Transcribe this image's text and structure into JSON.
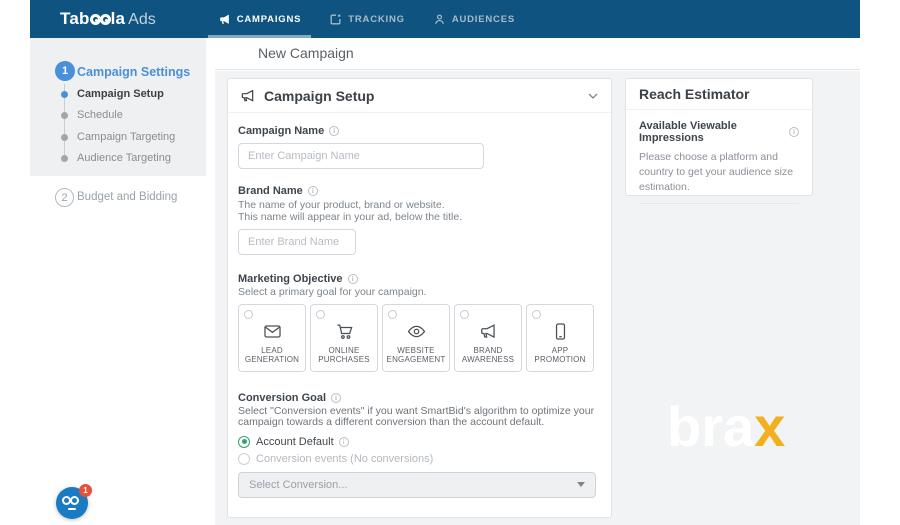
{
  "colors": {
    "navy": "#0f5480",
    "accent": "#4a90d9",
    "green": "#34a06b",
    "gold": "#f2b01e",
    "bg-gray": "#f2f3f5",
    "block-gray": "#eef0f1",
    "chat-blue": "#1a7ac2",
    "badge-red": "#e8503a"
  },
  "nav": {
    "logo": {
      "part1": "Tab",
      "part2": "la",
      "suffix": "Ads"
    },
    "items": [
      {
        "label": "CAMPAIGNS",
        "icon": "megaphone-icon",
        "active": true
      },
      {
        "label": "TRACKING",
        "icon": "tracking-pixel-icon",
        "active": false
      },
      {
        "label": "AUDIENCES",
        "icon": "person-icon",
        "active": false
      }
    ]
  },
  "sidebar": {
    "step1": {
      "number": "1",
      "label": "Campaign Settings",
      "sub": [
        "Campaign Setup",
        "Schedule",
        "Campaign Targeting",
        "Audience Targeting"
      ],
      "active_sub": "Campaign Setup"
    },
    "step2": {
      "number": "2",
      "label": "Budget and Bidding"
    }
  },
  "header": {
    "title": "New Campaign"
  },
  "campaign_setup": {
    "title": "Campaign Setup",
    "campaign_name": {
      "label": "Campaign Name",
      "placeholder": "Enter Campaign Name",
      "value": ""
    },
    "brand_name": {
      "label": "Brand Name",
      "help1": "The name of your product, brand or website.",
      "help2": "This name will appear in your ad, below the title.",
      "placeholder": "Enter Brand Name",
      "value": ""
    },
    "marketing_objective": {
      "label": "Marketing Objective",
      "help": "Select a primary goal for your campaign.",
      "options": [
        {
          "line1": "LEAD",
          "line2": "GENERATION",
          "icon": "envelope-icon",
          "selected": false
        },
        {
          "line1": "ONLINE",
          "line2": "PURCHASES",
          "icon": "cart-icon",
          "selected": false
        },
        {
          "line1": "WEBSITE",
          "line2": "ENGAGEMENT",
          "icon": "eye-icon",
          "selected": false
        },
        {
          "line1": "BRAND",
          "line2": "AWARENESS",
          "icon": "megaphone-icon",
          "selected": false
        },
        {
          "line1": "APP",
          "line2": "PROMOTION",
          "icon": "smartphone-icon",
          "selected": false
        }
      ]
    },
    "conversion_goal": {
      "label": "Conversion Goal",
      "help": "Select \"Conversion events\" if you want SmartBid's algorithm to optimize your campaign towards a different conversion than the account default.",
      "radios": [
        {
          "label": "Account Default",
          "selected": true,
          "disabled": false
        },
        {
          "label": "Conversion events (No conversions)",
          "selected": false,
          "disabled": true
        }
      ],
      "select_placeholder": "Select Conversion..."
    }
  },
  "reach_estimator": {
    "title": "Reach Estimator",
    "impressions_label": "Available Viewable Impressions",
    "message": "Please choose a platform and country to get your audience size estimation."
  },
  "watermark": {
    "part1": "bra",
    "part2": "x"
  },
  "chat": {
    "badge": "1"
  }
}
